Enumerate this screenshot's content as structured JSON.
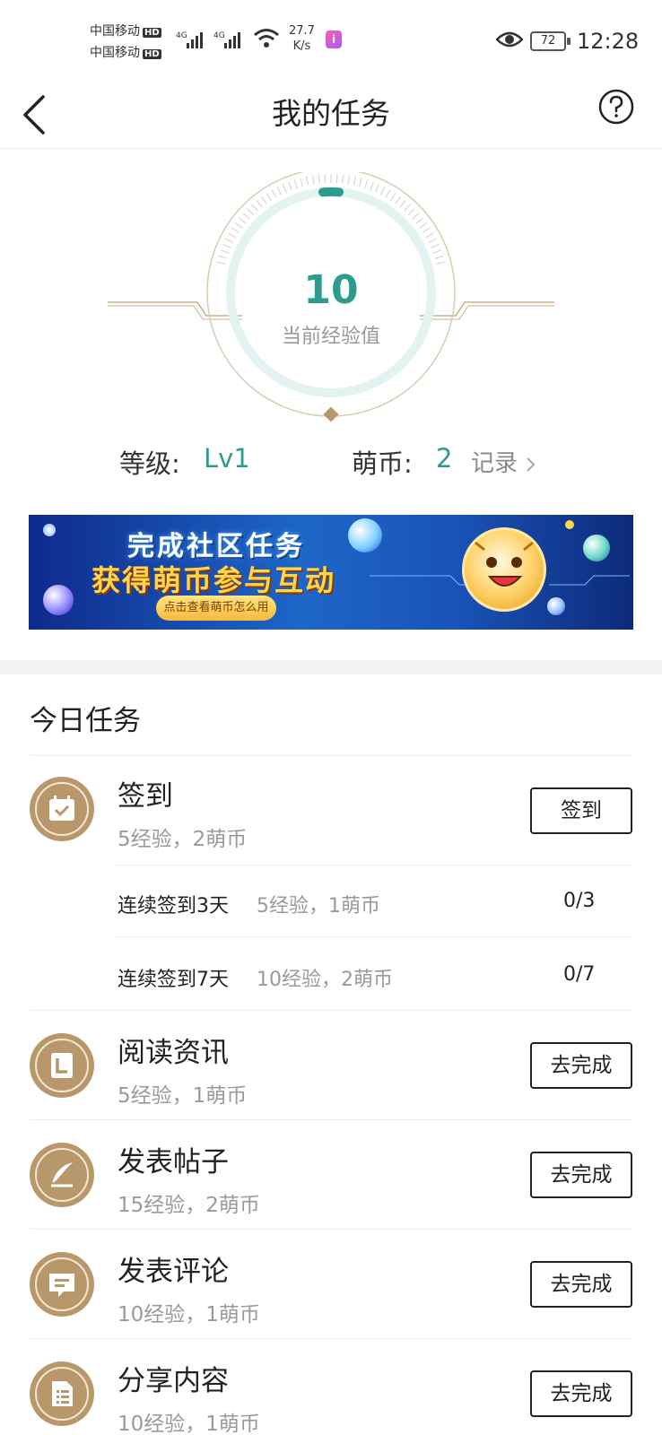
{
  "status_bar": {
    "carrier1": "中国移动",
    "carrier2": "中国移动",
    "hd": "HD",
    "network": "4G",
    "speed_value": "27.7",
    "speed_unit": "K/s",
    "battery": "72",
    "time": "12:28"
  },
  "header": {
    "title": "我的任务"
  },
  "experience": {
    "value": "10",
    "label": "当前经验值",
    "ring_color": "#2a9d8f"
  },
  "level": {
    "label": "等级:",
    "value": "Lv1",
    "coin_label": "萌币:",
    "coin_value": "2",
    "record": "记录"
  },
  "banner": {
    "line1": "完成社区任务",
    "line2": "获得萌币参与互动",
    "button": "点击查看萌币怎么用"
  },
  "tasks": {
    "section_title": "今日任务",
    "items": [
      {
        "name": "签到",
        "reward": "5经验，2萌币",
        "button": "签到",
        "icon": "calendar-check-icon"
      },
      {
        "name": "阅读资讯",
        "reward": "5经验，1萌币",
        "button": "去完成",
        "icon": "reading-icon"
      },
      {
        "name": "发表帖子",
        "reward": "15经验，2萌币",
        "button": "去完成",
        "icon": "quill-icon"
      },
      {
        "name": "发表评论",
        "reward": "10经验，1萌币",
        "button": "去完成",
        "icon": "comment-icon"
      },
      {
        "name": "分享内容",
        "reward": "10经验，1萌币",
        "button": "去完成",
        "icon": "document-icon"
      }
    ],
    "sub_items": [
      {
        "name": "连续签到3天",
        "reward": "5经验，1萌币",
        "progress": "0/3"
      },
      {
        "name": "连续签到7天",
        "reward": "10经验，2萌币",
        "progress": "0/7"
      }
    ]
  },
  "colors": {
    "accent": "#2a9d8f",
    "icon_bg": "#b8976a"
  }
}
